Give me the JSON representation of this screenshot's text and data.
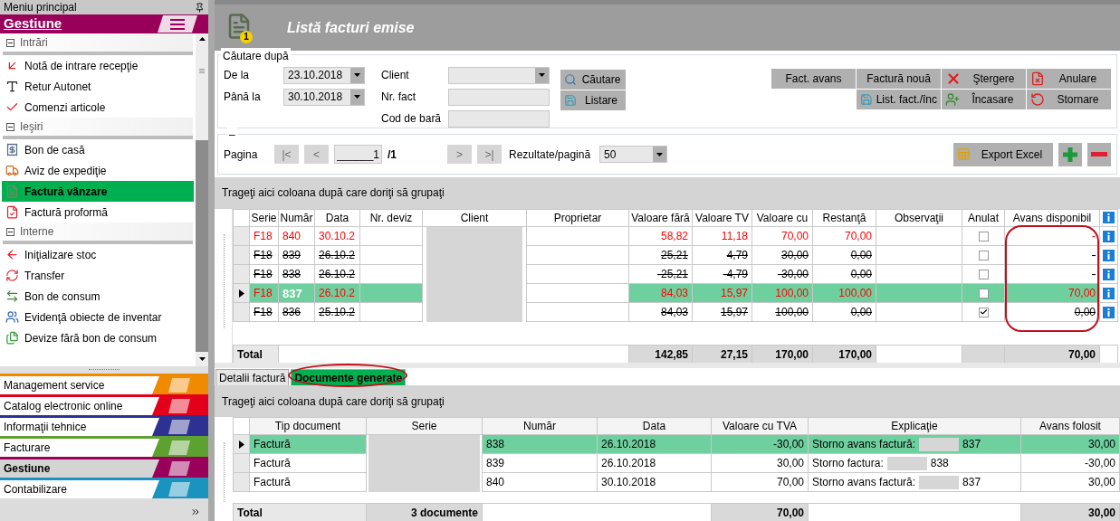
{
  "sidebar": {
    "title": "Meniu principal",
    "section": "Gestiune",
    "groups": [
      {
        "title": "Intrări",
        "expanded": true,
        "items": [
          {
            "label": "Notă de intrare recepţie",
            "selected": false
          },
          {
            "label": "Retur Autonet",
            "selected": false
          },
          {
            "label": "Comenzi articole",
            "selected": false
          }
        ]
      },
      {
        "title": "Ieşiri",
        "expanded": true,
        "items": [
          {
            "label": "Bon de casă",
            "selected": false
          },
          {
            "label": "Aviz de expediţie",
            "selected": false
          },
          {
            "label": "Factură vânzare",
            "selected": true
          },
          {
            "label": "Factură proformă",
            "selected": false
          }
        ]
      },
      {
        "title": "Interne",
        "expanded": true,
        "items": [
          {
            "label": "Iniţializare stoc",
            "selected": false
          },
          {
            "label": "Transfer",
            "selected": false
          },
          {
            "label": "Bon de consum",
            "selected": false
          },
          {
            "label": "Evidenţă obiecte de inventar",
            "selected": false
          },
          {
            "label": "Devize fără bon de consum",
            "selected": false
          }
        ]
      }
    ],
    "modules": [
      {
        "label": "Management service",
        "color": "#f08a00",
        "selected": false
      },
      {
        "label": "Catalog electronic online",
        "color": "#e2001a",
        "selected": false
      },
      {
        "label": "Informaţii tehnice",
        "color": "#2e3192",
        "selected": false
      },
      {
        "label": "Facturare",
        "color": "#5da130",
        "selected": false
      },
      {
        "label": "Gestiune",
        "color": "#98005a",
        "selected": true
      },
      {
        "label": "Contabilizare",
        "color": "#1b93bf",
        "selected": false
      }
    ]
  },
  "header": {
    "title": "Listă facturi emise",
    "badge": "1"
  },
  "search": {
    "legend": "Căutare după",
    "from": {
      "label": "De la",
      "value": "23.10.2018"
    },
    "to": {
      "label": "Până la",
      "value": "30.10.2018"
    },
    "client": {
      "label": "Client"
    },
    "invoice_no": {
      "label": "Nr. fact"
    },
    "barcode": {
      "label": "Cod de bară"
    },
    "buttons": [
      "Căutare",
      "Listare"
    ]
  },
  "actions": {
    "row_1": [
      "Fact. avans",
      "Factură nouă",
      "Ştergere",
      "Anulare"
    ],
    "row_2": [
      "List. fact./înc",
      "Încasare",
      "Stornare"
    ]
  },
  "paging": {
    "legend": "–",
    "label": "Pagina",
    "first": {
      "label": "|<",
      "disabled": true
    },
    "prev": {
      "label": "<",
      "disabled": true
    },
    "page": "______1",
    "of": "/1",
    "next": {
      "label": ">",
      "disabled": true
    },
    "last": {
      "label": ">|",
      "disabled": true
    },
    "per_page_label": "Rezultate/pagină",
    "per_page": "50",
    "export": "Export Excel"
  },
  "invoices": {
    "group_hint": "Trageţi aici coloana după care doriţi să grupaţi",
    "columns": [
      "Serie",
      "Număr",
      "Data",
      "Nr. deviz",
      "Client",
      "Proprietar",
      "Valoare fără",
      "Valoare TV",
      "Valoare cu",
      "Restanţă",
      "Observaţii",
      "Anulat",
      "Avans disponibil"
    ],
    "rows": [
      {
        "serie": "F18",
        "numar": "840",
        "data": "30.10.2",
        "valoare_fara": "58,82",
        "valoare_tv": "11,18",
        "valoare_cu": "70,00",
        "restanta": "70,00",
        "anulat": false,
        "avans_disponibil": "-",
        "selected": false,
        "struck": false
      },
      {
        "serie": "F18",
        "numar": "839",
        "data": "26.10.2",
        "valoare_fara": "25,21",
        "valoare_tv": "4,79",
        "valoare_cu": "30,00",
        "restanta": "0,00",
        "anulat": false,
        "avans_disponibil": "-",
        "selected": false,
        "struck": true
      },
      {
        "serie": "F18",
        "numar": "838",
        "data": "26.10.2",
        "valoare_fara": "-25,21",
        "valoare_tv": "-4,79",
        "valoare_cu": "-30,00",
        "restanta": "0,00",
        "anulat": false,
        "avans_disponibil": "-",
        "selected": false,
        "struck": true
      },
      {
        "serie": "F18",
        "numar": "837",
        "data": "26.10.2",
        "valoare_fara": "84,03",
        "valoare_tv": "15,97",
        "valoare_cu": "100,00",
        "restanta": "100,00",
        "anulat": false,
        "avans_disponibil": "70,00",
        "selected": true,
        "struck": false
      },
      {
        "serie": "F18",
        "numar": "836",
        "data": "25.10.2",
        "valoare_fara": "84,03",
        "valoare_tv": "15,97",
        "valoare_cu": "100,00",
        "restanta": "0,00",
        "anulat": true,
        "avans_disponibil": "0,00",
        "selected": false,
        "struck": true
      }
    ],
    "totals": {
      "label": "Total",
      "valoare_fara": "142,85",
      "valoare_tv": "27,15",
      "valoare_cu": "170,00",
      "restanta": "170,00",
      "avans_disponibil": "70,00"
    }
  },
  "detail_tabs": [
    {
      "label": "Detalii factură",
      "selected": false
    },
    {
      "label": "Documente generate",
      "selected": true
    }
  ],
  "documents": {
    "group_hint": "Trageţi aici coloana după care doriţi să grupaţi",
    "columns": [
      "Tip document",
      "Serie",
      "Număr",
      "Data",
      "Valoare cu TVA",
      "Explicaţie",
      "Avans folosit"
    ],
    "rows": [
      {
        "tip": "Factură",
        "numar": "838",
        "data": "26.10.2018",
        "valoare": "-30,00",
        "explicatie": "Storno avans factură:",
        "referinta": "837",
        "avans_folosit": "30,00",
        "selected": true
      },
      {
        "tip": "Factură",
        "numar": "839",
        "data": "26.10.2018",
        "valoare": "30,00",
        "explicatie": "Storno factura:",
        "referinta": "838",
        "avans_folosit": "-30,00",
        "selected": false
      },
      {
        "tip": "Factură",
        "numar": "840",
        "data": "30.10.2018",
        "valoare": "70,00",
        "explicatie": "Storno avans factură:",
        "referinta": "837",
        "avans_folosit": "30,00",
        "selected": false
      }
    ],
    "totals": {
      "label": "Total",
      "count": "3 documente",
      "valoare": "70,00",
      "avans_folosit": "30,00"
    }
  }
}
